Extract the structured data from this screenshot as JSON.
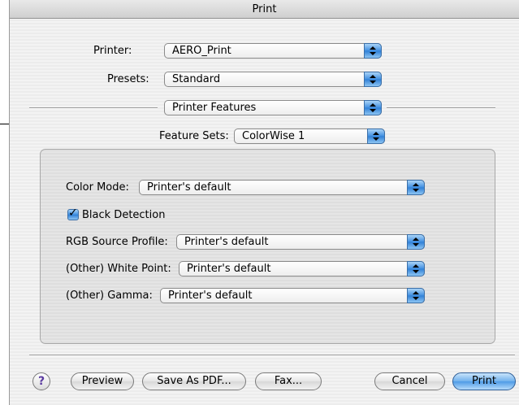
{
  "window": {
    "title": "Print"
  },
  "printer": {
    "label": "Printer:",
    "value": "AERO_Print"
  },
  "presets": {
    "label": "Presets:",
    "value": "Standard"
  },
  "panel": {
    "value": "Printer Features"
  },
  "feature_sets": {
    "label": "Feature Sets:",
    "value": "ColorWise 1"
  },
  "settings": {
    "color_mode": {
      "label": "Color Mode:",
      "value": "Printer's default"
    },
    "black_detection": {
      "label": "Black Detection",
      "checked": true
    },
    "rgb_source_profile": {
      "label": "RGB Source Profile:",
      "value": "Printer's default"
    },
    "white_point": {
      "label": "(Other) White Point:",
      "value": "Printer's default"
    },
    "gamma": {
      "label": "(Other) Gamma:",
      "value": "Printer's default"
    }
  },
  "buttons": {
    "help": "?",
    "preview": "Preview",
    "save_pdf": "Save As PDF...",
    "fax": "Fax...",
    "cancel": "Cancel",
    "print": "Print"
  },
  "icons": {
    "help": "question-mark-icon",
    "popup_arrows": "up-down-arrows-icon",
    "check": "checkmark-icon"
  },
  "colors": {
    "accent": "#3f8ee0",
    "window_bg": "#ececec",
    "group_bg": "#dedede"
  }
}
